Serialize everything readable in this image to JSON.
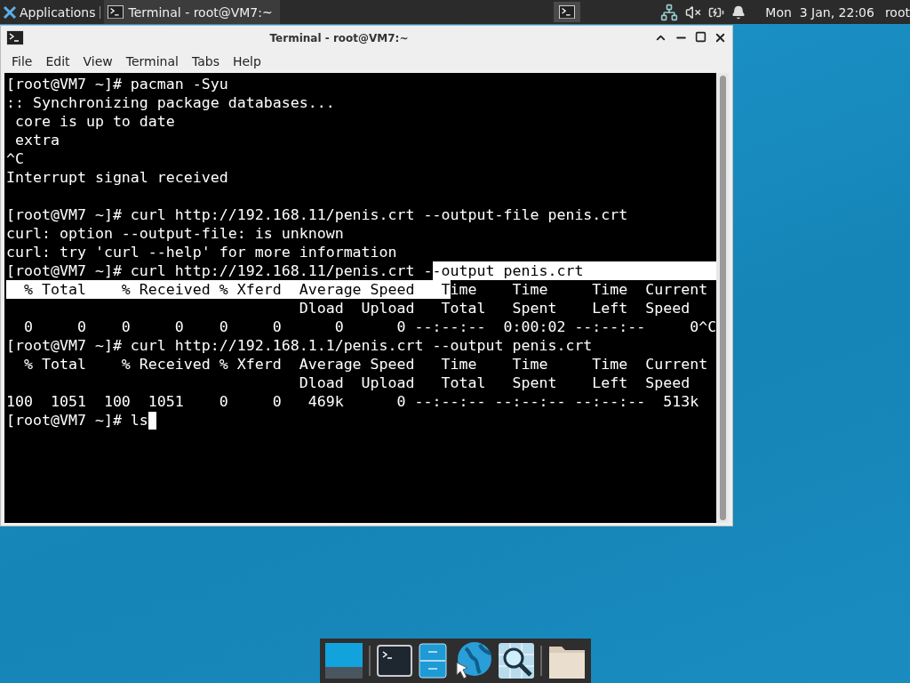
{
  "top_panel": {
    "apps_menu": "Applications",
    "tasks": [
      {
        "title": "Terminal - root@VM7:~",
        "selected": true
      }
    ],
    "clock": "Mon  3 Jan, 22:06",
    "user": "root"
  },
  "window": {
    "title": "Terminal - root@VM7:~",
    "menu": [
      "File",
      "Edit",
      "View",
      "Terminal",
      "Tabs",
      "Help"
    ]
  },
  "terminal": {
    "lines": [
      {
        "kind": "text",
        "segments": [
          {
            "text": "[root@VM7 ~]# pacman -Syu",
            "selected": false
          }
        ]
      },
      {
        "kind": "text",
        "segments": [
          {
            "text": ":: Synchronizing package databases...",
            "selected": false
          }
        ]
      },
      {
        "kind": "text",
        "segments": [
          {
            "text": " core is up to date",
            "selected": false
          }
        ]
      },
      {
        "kind": "text",
        "segments": [
          {
            "text": " extra",
            "selected": false
          }
        ]
      },
      {
        "kind": "text",
        "segments": [
          {
            "text": "^C",
            "selected": false
          }
        ]
      },
      {
        "kind": "text",
        "segments": [
          {
            "text": "Interrupt signal received",
            "selected": false
          }
        ]
      },
      {
        "kind": "blank"
      },
      {
        "kind": "text",
        "segments": [
          {
            "text": "[root@VM7 ~]# curl http://192.168.11/penis.crt --output-file penis.crt",
            "selected": false
          }
        ]
      },
      {
        "kind": "text",
        "segments": [
          {
            "text": "curl: option --output-file: is unknown",
            "selected": false
          }
        ]
      },
      {
        "kind": "text",
        "segments": [
          {
            "text": "curl: try 'curl --help' for more information",
            "selected": false
          }
        ]
      },
      {
        "kind": "text",
        "segments": [
          {
            "text": "[root@VM7 ~]# curl http://192.168.11/penis.crt -",
            "selected": false
          },
          {
            "text": "-output penis.crt",
            "selected": true
          }
        ]
      },
      {
        "kind": "text",
        "segments": [
          {
            "text": "  % Total    % Received % Xferd  Average Speed   T",
            "selected": true
          },
          {
            "text": "ime    Time     Time  Current",
            "selected": false
          }
        ]
      },
      {
        "kind": "text",
        "segments": [
          {
            "text": "                                 Dload  Upload   Total   Spent    Left  Speed",
            "selected": false
          }
        ]
      },
      {
        "kind": "text",
        "segments": [
          {
            "text": "  0     0    0     0    0     0      0      0 --:--:--  0:00:02 --:--:--     0^C",
            "selected": false
          }
        ]
      },
      {
        "kind": "text",
        "segments": [
          {
            "text": "[root@VM7 ~]# curl http://192.168.1.1/penis.crt --output penis.crt",
            "selected": false
          }
        ]
      },
      {
        "kind": "text",
        "segments": [
          {
            "text": "  % Total    % Received % Xferd  Average Speed   Time    Time     Time  Current",
            "selected": false
          }
        ]
      },
      {
        "kind": "text",
        "segments": [
          {
            "text": "                                 Dload  Upload   Total   Spent    Left  Speed",
            "selected": false
          }
        ]
      },
      {
        "kind": "text",
        "segments": [
          {
            "text": "100  1051  100  1051    0     0   469k      0 --:--:-- --:--:-- --:--:--  513k",
            "selected": false
          }
        ]
      },
      {
        "kind": "prompt",
        "segments": [
          {
            "text": "[root@VM7 ~]# ls",
            "selected": false
          }
        ]
      }
    ]
  },
  "dock": {
    "items": [
      {
        "kind": "desktop"
      },
      {
        "kind": "separator"
      },
      {
        "kind": "terminal"
      },
      {
        "kind": "files"
      },
      {
        "kind": "browser"
      },
      {
        "kind": "search"
      },
      {
        "kind": "separator"
      },
      {
        "kind": "folder"
      }
    ]
  }
}
